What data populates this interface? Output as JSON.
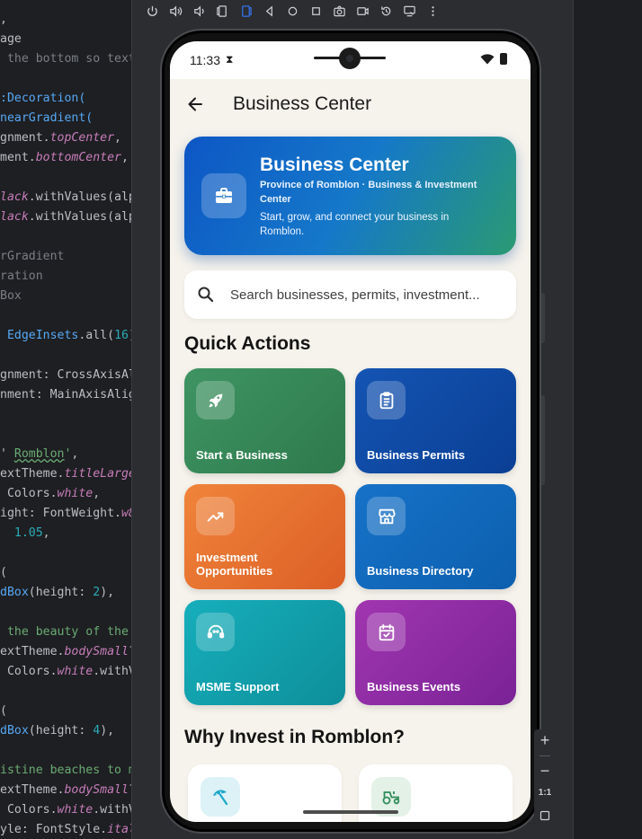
{
  "code": {
    "lines": [
      [
        {
          "t": ","
        }
      ],
      [
        {
          "t": "age"
        }
      ],
      [
        {
          "t": " the bottom so text",
          "c": "cmt"
        }
      ],
      [
        {
          "t": ""
        }
      ],
      [
        {
          "t": ":Decoration(",
          "c": "cls"
        }
      ],
      [
        {
          "t": "nearGradient(",
          "c": "cls"
        }
      ],
      [
        {
          "t": "gnment."
        },
        {
          "t": "topCenter",
          "c": "prop"
        },
        {
          "t": ","
        }
      ],
      [
        {
          "t": "ment."
        },
        {
          "t": "bottomCenter",
          "c": "prop"
        },
        {
          "t": ","
        }
      ],
      [
        {
          "t": ""
        }
      ],
      [
        {
          "t": "lack",
          "c": "prop"
        },
        {
          "t": ".withValues(alp"
        }
      ],
      [
        {
          "t": "lack",
          "c": "prop"
        },
        {
          "t": ".withValues(alp"
        }
      ],
      [
        {
          "t": ""
        }
      ],
      [
        {
          "t": "rGradient",
          "c": "cmt"
        }
      ],
      [
        {
          "t": "ration",
          "c": "cmt"
        }
      ],
      [
        {
          "t": "Box",
          "c": "cmt"
        }
      ],
      [
        {
          "t": ""
        }
      ],
      [
        {
          "t": " "
        },
        {
          "t": "EdgeInsets",
          "c": "cls"
        },
        {
          "t": ".all("
        },
        {
          "t": "16",
          "c": "num"
        },
        {
          "t": ")"
        }
      ],
      [
        {
          "t": ""
        }
      ],
      [
        {
          "t": "gnment: CrossAxisAl"
        }
      ],
      [
        {
          "t": "nment: MainAxisAlig"
        }
      ],
      [
        {
          "t": ""
        }
      ],
      [
        {
          "t": ""
        }
      ],
      [
        {
          "t": "' "
        },
        {
          "t": "Romblon",
          "c": "str ul"
        },
        {
          "t": "'",
          "c": "str"
        },
        {
          "t": ","
        }
      ],
      [
        {
          "t": "extTheme."
        },
        {
          "t": "titleLarge",
          "c": "prop"
        }
      ],
      [
        {
          "t": " Colors."
        },
        {
          "t": "white",
          "c": "prop"
        },
        {
          "t": ","
        }
      ],
      [
        {
          "t": "ight: FontWeight."
        },
        {
          "t": "w8",
          "c": "prop"
        }
      ],
      [
        {
          "t": "  "
        },
        {
          "t": "1.05",
          "c": "num"
        },
        {
          "t": ","
        }
      ],
      [
        {
          "t": ""
        }
      ],
      [
        {
          "t": "("
        }
      ],
      [
        {
          "t": "dBox",
          "c": "cls"
        },
        {
          "t": "(height: "
        },
        {
          "t": "2",
          "c": "num"
        },
        {
          "t": "),"
        }
      ],
      [
        {
          "t": ""
        }
      ],
      [
        {
          "t": " the beauty of the ",
          "c": "str"
        }
      ],
      [
        {
          "t": "extTheme."
        },
        {
          "t": "bodySmall",
          "c": "prop"
        },
        {
          "t": "?"
        }
      ],
      [
        {
          "t": " Colors."
        },
        {
          "t": "white",
          "c": "prop"
        },
        {
          "t": ".withV"
        }
      ],
      [
        {
          "t": ""
        }
      ],
      [
        {
          "t": "("
        }
      ],
      [
        {
          "t": "dBox",
          "c": "cls"
        },
        {
          "t": "(height: "
        },
        {
          "t": "4",
          "c": "num"
        },
        {
          "t": "),"
        }
      ],
      [
        {
          "t": ""
        }
      ],
      [
        {
          "t": "istine beaches to m",
          "c": "str"
        }
      ],
      [
        {
          "t": "extTheme."
        },
        {
          "t": "bodySmall",
          "c": "prop"
        },
        {
          "t": "?"
        }
      ],
      [
        {
          "t": " Colors."
        },
        {
          "t": "white",
          "c": "prop"
        },
        {
          "t": ".withV"
        }
      ],
      [
        {
          "t": "yle: FontStyle."
        },
        {
          "t": "ital",
          "c": "prop"
        }
      ]
    ]
  },
  "emulator": {
    "toolbar_icons": [
      "power-icon",
      "volume-up-icon",
      "volume-down-icon",
      "rotate-left-icon",
      "rotate-right-icon",
      "back-nav-icon",
      "home-nav-icon",
      "overview-nav-icon",
      "screenshot-icon",
      "record-icon",
      "snapshot-icon",
      "extended-controls-icon",
      "more-icon"
    ],
    "zoom_in": "+",
    "zoom_out": "−",
    "zoom_ratio": "1:1"
  },
  "status_bar": {
    "time": "11:33",
    "hourglass": "⧗"
  },
  "app_bar": {
    "title": "Business Center"
  },
  "hero": {
    "title": "Business Center",
    "subtitle": "Province of Romblon · Business & Investment Center",
    "description": "Start, grow, and connect your business in Romblon."
  },
  "search": {
    "placeholder": "Search businesses, permits, investment..."
  },
  "quick_actions": {
    "title": "Quick Actions",
    "items": [
      {
        "label": "Start a Business",
        "icon": "rocket-icon",
        "color": "#3f9463"
      },
      {
        "label": "Business Permits",
        "icon": "clipboard-icon",
        "color": "#1454b3"
      },
      {
        "label": "Investment Opportunities",
        "icon": "trending-up-icon",
        "color": "#f0843a"
      },
      {
        "label": "Business Directory",
        "icon": "storefront-icon",
        "color": "#1672c8"
      },
      {
        "label": "MSME Support",
        "icon": "support-agent-icon",
        "color": "#16aebb"
      },
      {
        "label": "Business Events",
        "icon": "calendar-check-icon",
        "color": "#a136b0"
      }
    ]
  },
  "why_invest": {
    "title": "Why Invest in Romblon?",
    "cards": [
      {
        "icon": "beach-umbrella-icon",
        "color": "#19a7c8"
      },
      {
        "icon": "tractor-icon",
        "color": "#2e8b57"
      }
    ]
  }
}
